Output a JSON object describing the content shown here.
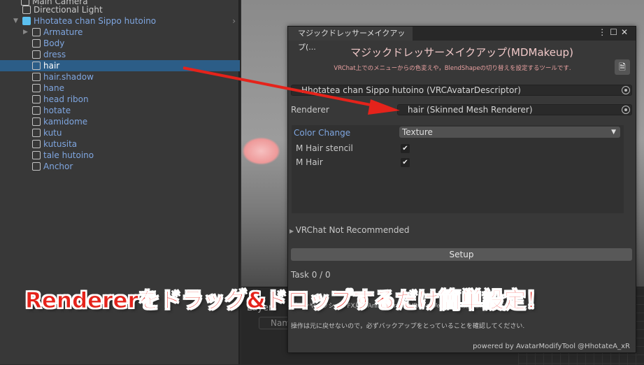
{
  "hierarchy": {
    "items": [
      {
        "label": "Main Camera"
      },
      {
        "label": "Directional Light"
      },
      {
        "label": "Hhotatea chan Sippo hutoino"
      },
      {
        "label": "Armature"
      },
      {
        "label": "Body"
      },
      {
        "label": "dress"
      },
      {
        "label": "hair"
      },
      {
        "label": "hair.shadow"
      },
      {
        "label": "hane"
      },
      {
        "label": "head ribon"
      },
      {
        "label": "hotate"
      },
      {
        "label": "kamidome"
      },
      {
        "label": "kutu"
      },
      {
        "label": "kutusita"
      },
      {
        "label": "tale hutoino"
      },
      {
        "label": "Anchor"
      }
    ]
  },
  "lower": {
    "layers_tab": "Layers",
    "search_placeholder": "Name"
  },
  "window": {
    "tab_title": "マジックドレッサーメイクアップ(...",
    "heading": "マジックドレッサーメイクアップ(MDMakeup)",
    "description": "VRChat上でのメニューからの色変えや，BlendShapeの切り替えを設定するツールです.",
    "avatar_field": "Hhotatea chan Sippo hutoino (VRCAvatarDescriptor)",
    "renderer_label": "Renderer",
    "renderer_field": "hair (Skinned Mesh Renderer)",
    "color_change_label": "Color Change",
    "color_change_value": "Texture",
    "materials": [
      {
        "label": "M Hair stencil",
        "checked": true
      },
      {
        "label": "M Hair",
        "checked": true
      }
    ],
    "not_recommended": "VRChat Not Recommended",
    "setup_button": "Setup",
    "task": "Task 0 / 0",
    "warning1": "ボーンやメッシュ、FX用のAnimatorなどVRChat Avatarに改変を加えます.",
    "warning2": "操作は元に戻せないので，必ずバックアップをとっていることを確認してください.",
    "powered": "powered by AvatarModifyTool @HhotateA_xR"
  },
  "caption": "Rendererをドラッグ&ドロップするだけ簡単設定！",
  "colors": {
    "accent": "#e5231b",
    "selection": "#2c5d87",
    "link": "#7fa6e0"
  }
}
